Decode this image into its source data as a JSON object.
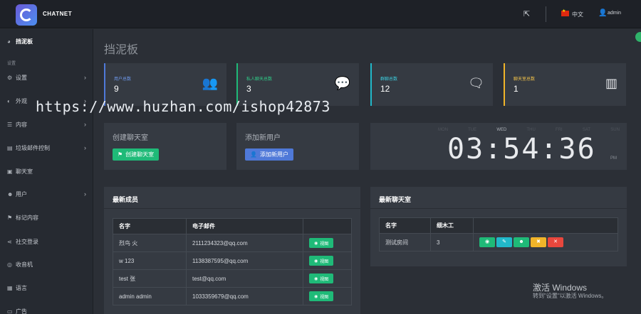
{
  "header": {
    "brand": "CHATNET",
    "language": "中文",
    "user": "admin"
  },
  "sidebar": {
    "dashboard": "挡泥板",
    "section": "设置",
    "items": [
      {
        "label": "设置",
        "icon": "gear-icon"
      },
      {
        "label": "外观",
        "icon": "palette-icon"
      },
      {
        "label": "内容",
        "icon": "list-icon"
      },
      {
        "label": "垃圾邮件控制",
        "icon": "filter-icon"
      },
      {
        "label": "聊天室",
        "icon": "chat-icon"
      },
      {
        "label": "用户",
        "icon": "users-icon"
      },
      {
        "label": "标记内容",
        "icon": "flag-icon"
      },
      {
        "label": "社交登录",
        "icon": "share-icon"
      },
      {
        "label": "收音机",
        "icon": "radio-icon"
      },
      {
        "label": "语言",
        "icon": "language-icon"
      },
      {
        "label": "广告",
        "icon": "ad-icon"
      }
    ]
  },
  "main": {
    "page_title": "挡泥板",
    "stats": [
      {
        "label": "用户总数",
        "value": "9",
        "color": "#4f79d8",
        "icon": "users-icon"
      },
      {
        "label": "私人聊天总数",
        "value": "3",
        "color": "#1fba78",
        "icon": "chat-bubble-icon"
      },
      {
        "label": "群聊总数",
        "value": "12",
        "color": "#21b8c9",
        "icon": "chat-bubbles-icon"
      },
      {
        "label": "聊天室总数",
        "value": "1",
        "color": "#f0b429",
        "icon": "room-icon"
      }
    ],
    "create_room": {
      "title": "创建聊天室",
      "button": "创建聊天室"
    },
    "add_user": {
      "title": "添加新用户",
      "button": "添加新用户"
    },
    "clock": {
      "days": [
        "MON",
        "TUE",
        "WED",
        "THU",
        "FRI",
        "SAT",
        "SUN"
      ],
      "time": "03:54:36",
      "ampm": "PM"
    },
    "members": {
      "title": "最新成员",
      "columns": [
        "名字",
        "电子邮件"
      ],
      "view_label": "视图",
      "rows": [
        {
          "name": "烈鸟 火",
          "email": "2111234323@qq.com"
        },
        {
          "name": "w 123",
          "email": "1138387595@qq.com"
        },
        {
          "name": "test 张",
          "email": "test@qq.com"
        },
        {
          "name": "admin admin",
          "email": "1033359679@qq.com"
        }
      ]
    },
    "rooms": {
      "title": "最新聊天室",
      "columns": [
        "名字",
        "细木工"
      ],
      "rows": [
        {
          "name": "测试房间",
          "count": "3"
        }
      ]
    }
  },
  "overlay": {
    "watermark": "https://www.huzhan.com/ishop42873",
    "activate_title": "激活 Windows",
    "activate_sub": "转到\"设置\"以激活 Windows。"
  }
}
